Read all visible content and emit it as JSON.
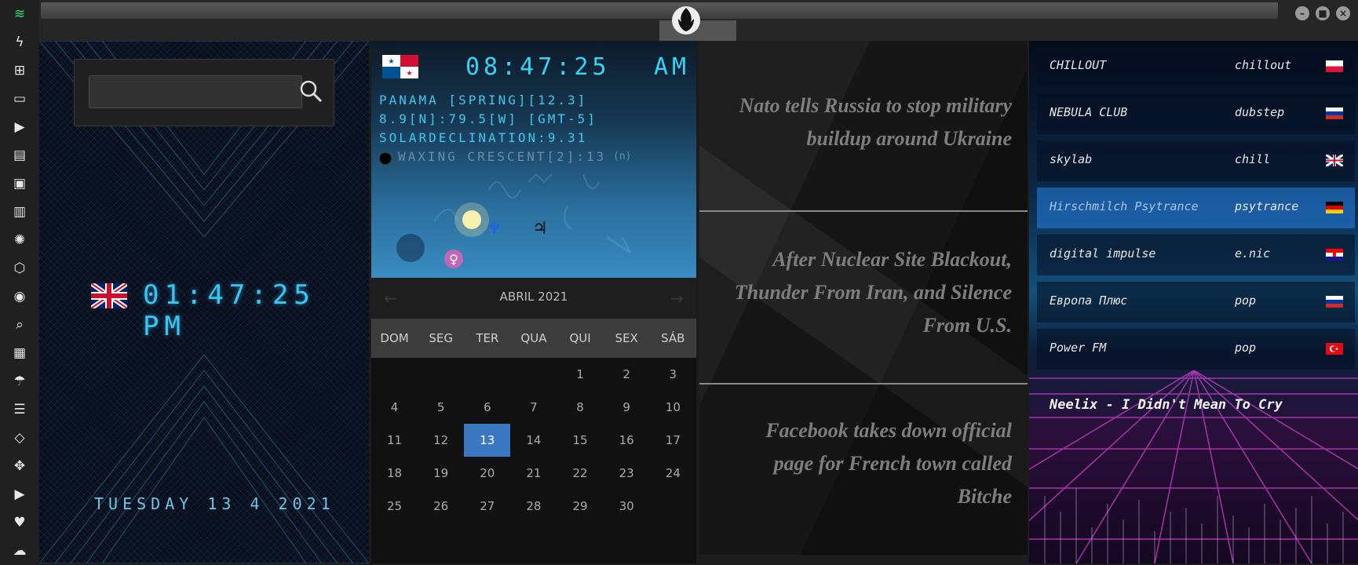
{
  "titlebar": {
    "buttons": [
      "minimize",
      "maximize",
      "close"
    ]
  },
  "sidebar": {
    "icons": [
      "wifi-icon",
      "bolt-icon",
      "windows-icon",
      "archive-icon",
      "play-icon",
      "book-icon",
      "image-icon",
      "news-icon",
      "atom-icon",
      "hexagon-icon",
      "globe-icon",
      "search-icon",
      "map-icon",
      "umbrella-icon",
      "contacts-icon",
      "code-icon",
      "expand-icon",
      "youtube-icon",
      "heart-icon",
      "cloud-icon"
    ]
  },
  "left_panel": {
    "search_placeholder": "",
    "time": "01:47:25 PM",
    "date": "TUESDAY 13 4 2021"
  },
  "astro": {
    "time": "08:47:25",
    "ampm": "AM",
    "line1": "PANAMA [SPRING][12.3]",
    "line2": "8.9[N]:79.5[W] [GMT-5]",
    "line3": "SOLARDECLINATION:9.31",
    "moon": "WAXING CRESCENT[2]:13",
    "moon_suffix": "(n)"
  },
  "calendar": {
    "prev": "←",
    "next": "→",
    "title": "ABRIL 2021",
    "weekdays": [
      "DOM",
      "SEG",
      "TER",
      "QUA",
      "QUI",
      "SEX",
      "SÁB"
    ],
    "days": [
      {
        "n": "1",
        "col": 4,
        "row": 0
      },
      {
        "n": "2",
        "col": 5,
        "row": 0
      },
      {
        "n": "3",
        "col": 6,
        "row": 0
      },
      {
        "n": "4",
        "col": 0,
        "row": 1
      },
      {
        "n": "5",
        "col": 1,
        "row": 1
      },
      {
        "n": "6",
        "col": 2,
        "row": 1
      },
      {
        "n": "7",
        "col": 3,
        "row": 1
      },
      {
        "n": "8",
        "col": 4,
        "row": 1
      },
      {
        "n": "9",
        "col": 5,
        "row": 1
      },
      {
        "n": "10",
        "col": 6,
        "row": 1
      },
      {
        "n": "11",
        "col": 0,
        "row": 2
      },
      {
        "n": "12",
        "col": 1,
        "row": 2
      },
      {
        "n": "13",
        "col": 2,
        "row": 2,
        "selected": true
      },
      {
        "n": "14",
        "col": 3,
        "row": 2
      },
      {
        "n": "15",
        "col": 4,
        "row": 2
      },
      {
        "n": "16",
        "col": 5,
        "row": 2
      },
      {
        "n": "17",
        "col": 6,
        "row": 2
      },
      {
        "n": "18",
        "col": 0,
        "row": 3
      },
      {
        "n": "19",
        "col": 1,
        "row": 3
      },
      {
        "n": "20",
        "col": 2,
        "row": 3
      },
      {
        "n": "21",
        "col": 3,
        "row": 3
      },
      {
        "n": "22",
        "col": 4,
        "row": 3
      },
      {
        "n": "23",
        "col": 5,
        "row": 3
      },
      {
        "n": "24",
        "col": 6,
        "row": 3
      },
      {
        "n": "25",
        "col": 0,
        "row": 4
      },
      {
        "n": "26",
        "col": 1,
        "row": 4
      },
      {
        "n": "27",
        "col": 2,
        "row": 4
      },
      {
        "n": "28",
        "col": 3,
        "row": 4
      },
      {
        "n": "29",
        "col": 4,
        "row": 4
      },
      {
        "n": "30",
        "col": 5,
        "row": 4
      }
    ]
  },
  "news": [
    "Nato tells Russia to stop military buildup around Ukraine",
    "After Nuclear Site Blackout, Thunder From Iran, and Silence From U.S.",
    "Facebook takes down official page for French town called Bitche"
  ],
  "radio": {
    "stations": [
      {
        "name": "CHILLOUT",
        "genre": "chillout",
        "flag": "PL"
      },
      {
        "name": "NEBULA CLUB",
        "genre": "dubstep",
        "flag": "RU"
      },
      {
        "name": "skylab",
        "genre": "chill",
        "flag": "GB"
      },
      {
        "name": "Hirschmilch Psytrance",
        "genre": "psytrance",
        "flag": "DE",
        "active": true
      },
      {
        "name": "digital impulse",
        "genre": "e.nic",
        "flag": "HR"
      },
      {
        "name": "Европа Плюс",
        "genre": "pop",
        "flag": "RU"
      },
      {
        "name": "Power FM",
        "genre": "pop",
        "flag": "TR"
      }
    ],
    "now_playing": "Neelix - I Didn't Mean To Cry"
  }
}
